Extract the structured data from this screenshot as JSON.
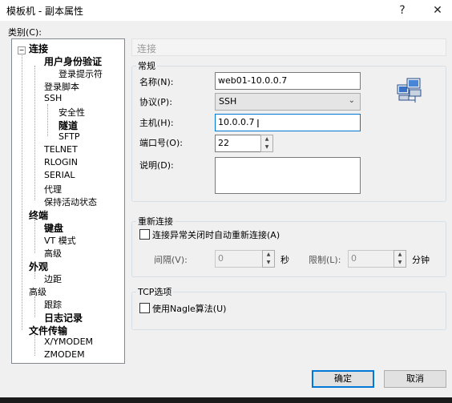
{
  "window": {
    "title": "模板机 - 副本属性",
    "help_glyph": "?",
    "close_glyph": "✕"
  },
  "category_label": "类别(C):",
  "tree": {
    "connection": "连接",
    "user_auth": "用户身份验证",
    "login_prompt": "登录提示符",
    "login_script": "登录脚本",
    "ssh": "SSH",
    "security": "安全性",
    "tunnel": "隧道",
    "sftp": "SFTP",
    "telnet": "TELNET",
    "rlogin": "RLOGIN",
    "serial": "SERIAL",
    "proxy": "代理",
    "keepalive": "保持活动状态",
    "terminal": "终端",
    "keyboard": "键盘",
    "vt_mode": "VT 模式",
    "advanced": "高级",
    "appearance": "外观",
    "margin": "边距",
    "advanced2": "高级",
    "trace": "跟踪",
    "log": "日志记录",
    "file_transfer": "文件传输",
    "xymodem": "X/YMODEM",
    "zmodem": "ZMODEM"
  },
  "section_title": "连接",
  "general": {
    "title": "常规",
    "name_label": "名称(N):",
    "name_value": "web01-10.0.0.7",
    "protocol_label": "协议(P):",
    "protocol_value": "SSH",
    "host_label": "主机(H):",
    "host_value": "10.0.0.7",
    "port_label": "端口号(O):",
    "port_value": "22",
    "desc_label": "说明(D):",
    "desc_value": ""
  },
  "reconnect": {
    "title": "重新连接",
    "auto_label": "连接异常关闭时自动重新连接(A)",
    "interval_label": "间隔(V):",
    "interval_value": "0",
    "seconds": "秒",
    "limit_label": "限制(L):",
    "limit_value": "0",
    "minutes": "分钟"
  },
  "tcp": {
    "title": "TCP选项",
    "nagle_label": "使用Nagle算法(U)"
  },
  "buttons": {
    "ok": "确定",
    "cancel": "取消"
  }
}
